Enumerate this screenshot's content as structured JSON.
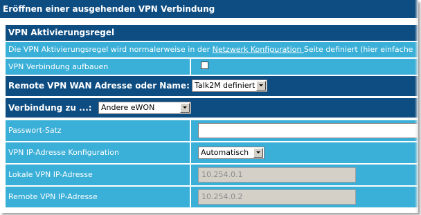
{
  "title": "Eröffnen einer ausgehenden VPN Verbindung",
  "activation": {
    "header": "VPN Aktivierungsregel",
    "note_prefix": "Die VPN Aktivierungsregel wird normalerweise in der ",
    "note_link": "Netzwerk Konfiguration ",
    "note_suffix": "Seite definiert (hier einfache",
    "checkbox_label": "VPN Verbindung aufbauen",
    "checkbox_checked": false
  },
  "remote_wan": {
    "label": "Remote VPN WAN Adresse oder Name:",
    "selected": "Talk2M definiert"
  },
  "connection": {
    "label": "Verbindung zu ...:",
    "selected": "Andere eWON"
  },
  "fields": [
    {
      "label": "Passwort-Satz",
      "value": "",
      "type": "password"
    },
    {
      "label": "VPN IP-Adresse Konfiguration",
      "value": "Automatisch",
      "type": "select"
    },
    {
      "label": "Lokale VPN IP-Adresse",
      "value": "10.254.0.1",
      "type": "disabled"
    },
    {
      "label": "Remote VPN IP-Adresse",
      "value": "10.254.0.2",
      "type": "disabled"
    }
  ],
  "colors": {
    "header": "#0e4d82",
    "row": "#3aafd7"
  }
}
